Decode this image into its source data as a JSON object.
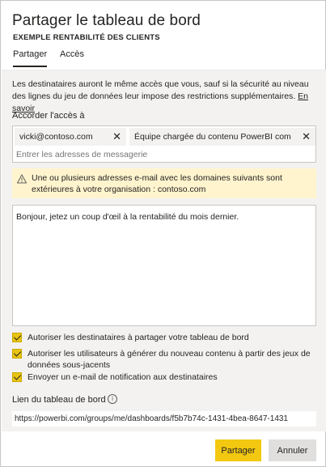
{
  "dialog": {
    "title": "Partager le tableau de bord",
    "subtitle": "EXEMPLE RENTABILITÉ DES CLIENTS"
  },
  "tabs": [
    {
      "label": "Partager",
      "active": true
    },
    {
      "label": "Accès",
      "active": false
    }
  ],
  "description": {
    "text": "Les destinataires auront le même accès que vous, sauf si la sécurité au niveau des lignes du jeu de données leur impose des restrictions supplémentaires. ",
    "link": "En savoir"
  },
  "access": {
    "label": "Accorder l'accès à",
    "recipients": [
      {
        "name": "vicki@contoso.com",
        "remove_icon": "close-icon"
      },
      {
        "name": "Équipe chargée du contenu PowerBI com",
        "remove_icon": "close-icon"
      }
    ],
    "input_placeholder": "Entrer les adresses de messagerie"
  },
  "warning": {
    "icon": "warning-icon",
    "text": "Une ou plusieurs adresses e-mail avec les domaines suivants sont extérieures à votre organisation : contoso.com",
    "color": "#fff4ce"
  },
  "message": {
    "value": "Bonjour, jetez un coup d'œil à la rentabilité du mois dernier."
  },
  "options": [
    {
      "label": "Autoriser les destinataires à partager votre tableau de bord",
      "checked": true
    },
    {
      "label": "Autoriser les utilisateurs à générer du nouveau contenu à partir des jeux de données sous-jacents",
      "checked": true
    },
    {
      "label": "Envoyer un e-mail de notification aux destinataires",
      "checked": true
    }
  ],
  "link": {
    "label": "Lien du tableau de bord",
    "info_icon": "info-icon",
    "url": "https://powerbi.com/groups/me/dashboards/f5b7b74c-1431-4bea-8647-1431"
  },
  "buttons": {
    "share": "Partager",
    "cancel": "Annuler",
    "accent_color": "#f2c811"
  }
}
